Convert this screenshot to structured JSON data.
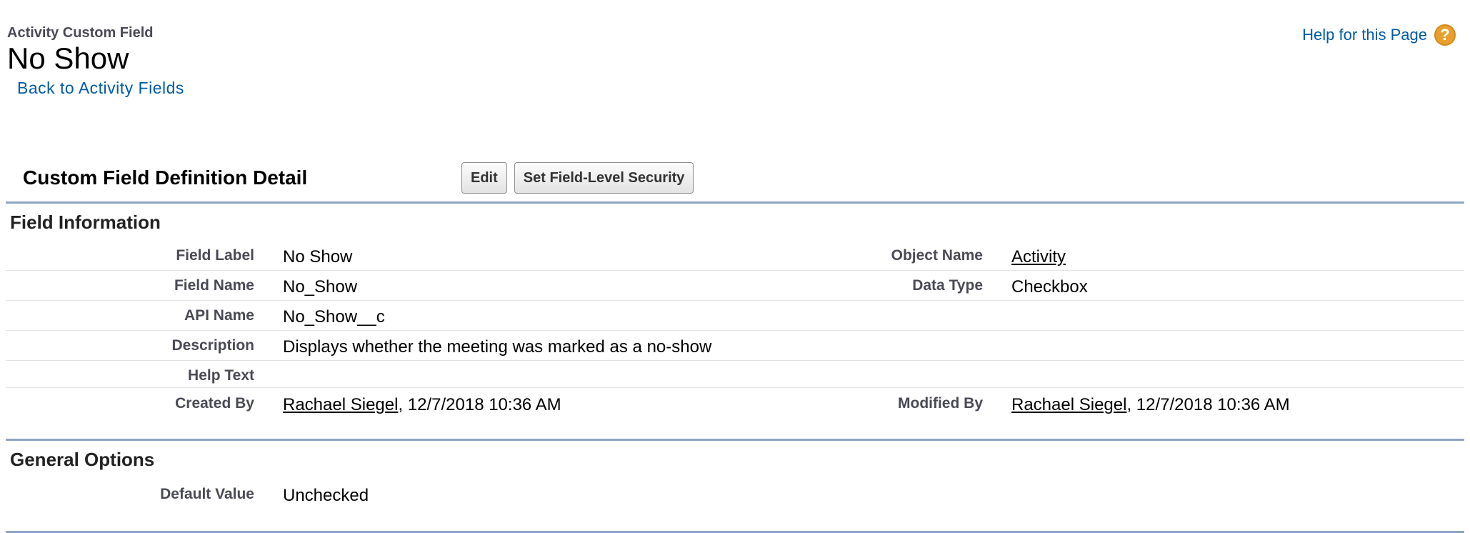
{
  "header": {
    "object_type": "Activity Custom Field",
    "title": "No Show",
    "back_link": "Back to Activity Fields",
    "help_link": "Help for this Page",
    "help_icon_glyph": "?"
  },
  "detail": {
    "title": "Custom Field Definition Detail",
    "buttons": {
      "edit": "Edit",
      "security": "Set Field-Level Security"
    }
  },
  "field_information": {
    "section_title": "Field Information",
    "field_label": {
      "label": "Field Label",
      "value": "No Show"
    },
    "object_name": {
      "label": "Object Name",
      "value": "Activity"
    },
    "field_name": {
      "label": "Field Name",
      "value": "No_Show"
    },
    "data_type": {
      "label": "Data Type",
      "value": "Checkbox"
    },
    "api_name": {
      "label": "API Name",
      "value": "No_Show__c"
    },
    "description": {
      "label": "Description",
      "value": "Displays whether the meeting was marked as a no-show"
    },
    "help_text": {
      "label": "Help Text",
      "value": ""
    },
    "created_by": {
      "label": "Created By",
      "user": "Rachael Siegel",
      "date": ", 12/7/2018 10:36 AM"
    },
    "modified_by": {
      "label": "Modified By",
      "user": "Rachael Siegel",
      "date": ", 12/7/2018 10:36 AM"
    }
  },
  "general_options": {
    "section_title": "General Options",
    "default_value": {
      "label": "Default Value",
      "value": "Unchecked"
    }
  },
  "colors": {
    "link": "#015ba7",
    "label": "#4a4a56",
    "rule": "#8ea4c3",
    "help_icon": "#e8a02c"
  }
}
